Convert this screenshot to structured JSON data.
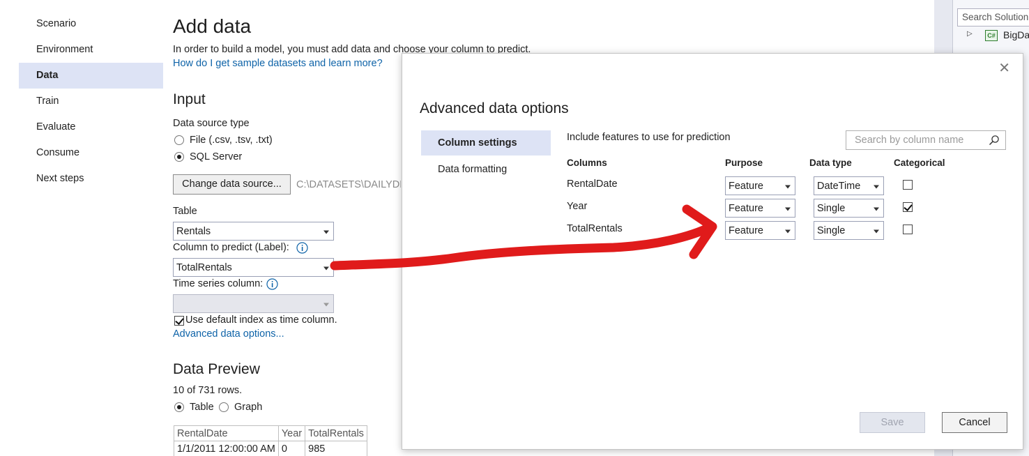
{
  "nav": {
    "items": [
      {
        "label": "Scenario"
      },
      {
        "label": "Environment"
      },
      {
        "label": "Data"
      },
      {
        "label": "Train"
      },
      {
        "label": "Evaluate"
      },
      {
        "label": "Consume"
      },
      {
        "label": "Next steps"
      }
    ],
    "active": "Data"
  },
  "main": {
    "title": "Add data",
    "intro": "In order to build a model, you must add data and choose your column to predict.",
    "help_link": "How do I get sample datasets and learn more?",
    "input_heading": "Input",
    "data_source_type_label": "Data source type",
    "source_options": [
      {
        "label": "File (.csv, .tsv, .txt)",
        "selected": false
      },
      {
        "label": "SQL Server",
        "selected": true
      }
    ],
    "change_source_button": "Change data source...",
    "source_path": "C:\\DATASETS\\DAILYDE",
    "table_label": "Table",
    "table_value": "Rentals",
    "label_column_label": "Column to predict (Label):",
    "label_column_value": "TotalRentals",
    "time_series_label": "Time series column:",
    "time_series_value": "",
    "default_index_label": "Use default index as time column.",
    "default_index_checked": true,
    "advanced_link": "Advanced data options...",
    "preview_heading": "Data Preview",
    "row_count": "10 of 731 rows.",
    "view_options": [
      {
        "label": "Table",
        "selected": true
      },
      {
        "label": "Graph",
        "selected": false
      }
    ],
    "preview_table": {
      "headers": [
        "RentalDate",
        "Year",
        "TotalRentals"
      ],
      "rows": [
        [
          "1/1/2011 12:00:00 AM",
          "0",
          "985"
        ]
      ]
    }
  },
  "solution_explorer": {
    "search_placeholder": "Search Solution",
    "item_label": "BigDa"
  },
  "dialog": {
    "title": "Advanced data options",
    "close_glyph": "✕",
    "tabs": [
      {
        "label": "Column settings",
        "active": true
      },
      {
        "label": "Data formatting",
        "active": false
      }
    ],
    "include_text": "Include features to use for prediction",
    "search_placeholder": "Search by column name",
    "column_headers": {
      "columns": "Columns",
      "purpose": "Purpose",
      "data_type": "Data type",
      "categorical": "Categorical"
    },
    "rows": [
      {
        "name": "RentalDate",
        "purpose": "Feature",
        "data_type": "DateTime",
        "categorical": false
      },
      {
        "name": "Year",
        "purpose": "Feature",
        "data_type": "Single",
        "categorical": true
      },
      {
        "name": "TotalRentals",
        "purpose": "Feature",
        "data_type": "Single",
        "categorical": false
      }
    ],
    "save_button": "Save",
    "cancel_button": "Cancel"
  },
  "colors": {
    "accent_link": "#0e63a8",
    "active_bg": "#dde3f5",
    "annotation_arrow": "#e01b1b"
  }
}
